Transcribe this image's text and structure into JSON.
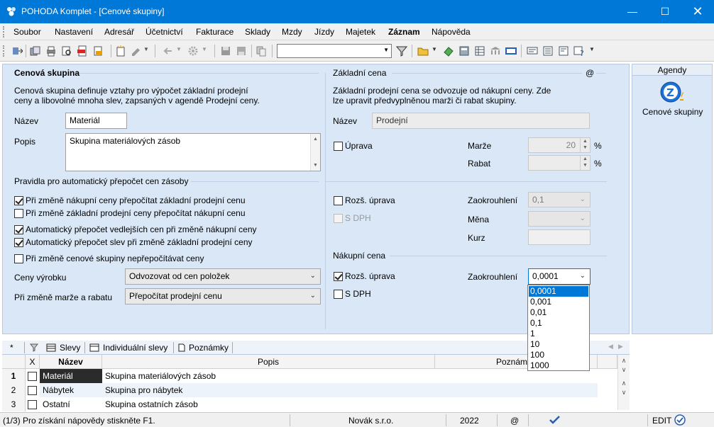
{
  "window": {
    "title": "POHODA Komplet - [Cenové skupiny]"
  },
  "menu": [
    "Soubor",
    "Nastavení",
    "Adresář",
    "Účetnictví",
    "Fakturace",
    "Sklady",
    "Mzdy",
    "Jízdy",
    "Majetek",
    "Záznam",
    "Nápověda"
  ],
  "toolbar": {
    "search_value": ""
  },
  "left": {
    "group_title": "Cenová skupina",
    "description": [
      "Cenová skupina definuje vztahy pro výpočet základní prodejní",
      "ceny a libovolné mnoha slev, zapsaných v agendě Prodejní ceny."
    ],
    "nazev_label": "Název",
    "nazev_value": "Materiál",
    "popis_label": "Popis",
    "popis_value": "Skupina materiálových zásob",
    "rules_title": "Pravidla pro automatický přepočet cen zásoby",
    "rules": [
      {
        "label": "Při změně nákupní ceny přepočítat základní prodejní cenu",
        "checked": true
      },
      {
        "label": "Při změně základní prodejní ceny přepočítat nákupní cenu",
        "checked": false
      },
      {
        "label": "Automatický přepočet vedlejších cen při změně nákupní ceny",
        "checked": true
      },
      {
        "label": "Automatický přepočet slev při změně základní prodejní ceny",
        "checked": true
      },
      {
        "label": "Při změně cenové skupiny nepřepočítávat ceny",
        "checked": false
      }
    ],
    "ceny_label": "Ceny výrobku",
    "ceny_value": "Odvozovat od cen položek",
    "marze_label": "Při změně marže a rabatu",
    "marze_value": "Přepočítat prodejní cenu"
  },
  "right": {
    "group_title": "Základní cena",
    "at": "@",
    "description": [
      "Základní prodejní cena se odvozuje od nákupní ceny. Zde",
      "lze upravit předvyplněnou marži či rabat skupiny."
    ],
    "nazev_label": "Název",
    "nazev_value": "Prodejní",
    "uprava_label": "Úprava",
    "marze_label": "Marže",
    "marze_value": "20",
    "rabat_label": "Rabat",
    "rabat_value": "",
    "pct": "%",
    "rozs_label": "Rozš. úprava",
    "zaokr_label": "Zaokrouhlení",
    "zaokr_value": "0,1",
    "sdph_label": "S DPH",
    "mena_label": "Měna",
    "kurz_label": "Kurz",
    "nakup_title": "Nákupní cena",
    "nakup_rozs_label": "Rozš. úprava",
    "nakup_zaokr_label": "Zaokrouhlení",
    "nakup_zaokr_value": "0,0001",
    "nakup_sdph_label": "S DPH",
    "dropdown_options": [
      "0,0001",
      "0,001",
      "0,01",
      "0,1",
      "1",
      "10",
      "100",
      "1000"
    ]
  },
  "agenda": {
    "header": "Agendy",
    "item_label": "Cenové skupiny"
  },
  "tabs": {
    "star": "*",
    "slevy": "Slevy",
    "individualni": "Individuální slevy",
    "poznamky": "Poznámky"
  },
  "grid": {
    "headers": {
      "x": "X",
      "nazev": "Název",
      "popis": "Popis",
      "poznamky": "Poznám"
    },
    "rows": [
      {
        "n": "1",
        "nazev": "Materiál",
        "popis": "Skupina materiálových zásob"
      },
      {
        "n": "2",
        "nazev": "Nábytek",
        "popis": "Skupina pro nábytek"
      },
      {
        "n": "3",
        "nazev": "Ostatní",
        "popis": "Skupina ostatních zásob"
      }
    ]
  },
  "status": {
    "record": "(1/3) Pro získání nápovědy stiskněte F1.",
    "company": "Novák s.r.o.",
    "year": "2022",
    "at": "@",
    "mode": "EDIT"
  },
  "colors": {
    "titlebar": "#0078d7",
    "panel": "#d9e7f7",
    "selection": "#0078d7"
  }
}
